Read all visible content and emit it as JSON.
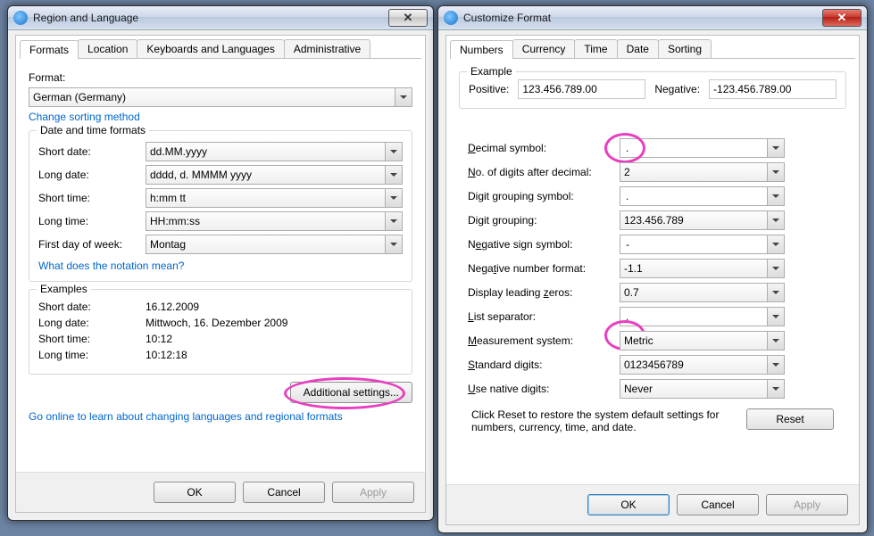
{
  "left": {
    "title": "Region and Language",
    "tabs": [
      "Formats",
      "Location",
      "Keyboards and Languages",
      "Administrative"
    ],
    "format_label": "Format:",
    "format_value": "German (Germany)",
    "change_sort": "Change sorting method",
    "dt_group": "Date and time formats",
    "rows": {
      "short_date_l": "Short date:",
      "short_date_v": "dd.MM.yyyy",
      "long_date_l": "Long date:",
      "long_date_v": "dddd, d. MMMM yyyy",
      "short_time_l": "Short time:",
      "short_time_v": "h:mm tt",
      "long_time_l": "Long time:",
      "long_time_v": "HH:mm:ss",
      "first_dow_l": "First day of week:",
      "first_dow_v": "Montag"
    },
    "notation_link": "What does the notation mean?",
    "ex_group": "Examples",
    "ex": {
      "sd_l": "Short date:",
      "sd_v": "16.12.2009",
      "ld_l": "Long date:",
      "ld_v": "Mittwoch, 16. Dezember 2009",
      "st_l": "Short time:",
      "st_v": "10:12",
      "lt_l": "Long time:",
      "lt_v": "10:12:18"
    },
    "additional": "Additional settings...",
    "online_link": "Go online to learn about changing languages and regional formats",
    "ok": "OK",
    "cancel": "Cancel",
    "apply": "Apply"
  },
  "right": {
    "title": "Customize Format",
    "tabs": [
      "Numbers",
      "Currency",
      "Time",
      "Date",
      "Sorting"
    ],
    "ex_group": "Example",
    "pos_l": "Positive:",
    "pos_v": "123.456.789.00",
    "neg_l": "Negative:",
    "neg_v": "-123.456.789.00",
    "rows": {
      "dec_sym": {
        "l": "Decimal symbol:",
        "u": "D",
        "v": "."
      },
      "digits": {
        "l": "No. of digits after decimal:",
        "u": "N",
        "v": "2"
      },
      "grp_sym": {
        "l": "Digit grouping symbol:",
        "u": "",
        "v": "."
      },
      "grouping": {
        "l": "Digit grouping:",
        "u": "g",
        "v": "123.456.789"
      },
      "neg_sym": {
        "l": "Negative sign symbol:",
        "u": "e",
        "v": "-"
      },
      "neg_fmt": {
        "l": "Negative number format:",
        "u": "t",
        "v": "-1.1"
      },
      "lead_zero": {
        "l": "Display leading zeros:",
        "u": "z",
        "v": "0.7"
      },
      "list_sep": {
        "l": "List separator:",
        "u": "L",
        "v": ","
      },
      "meas": {
        "l": "Measurement system:",
        "u": "M",
        "v": "Metric"
      },
      "std_dig": {
        "l": "Standard digits:",
        "u": "S",
        "v": "0123456789"
      },
      "native": {
        "l": "Use native digits:",
        "u": "U",
        "v": "Never"
      }
    },
    "reset_note": "Click Reset to restore the system default settings for numbers, currency, time, and date.",
    "reset": "Reset",
    "reset_u": "R",
    "ok": "OK",
    "cancel": "Cancel",
    "apply": "Apply"
  }
}
